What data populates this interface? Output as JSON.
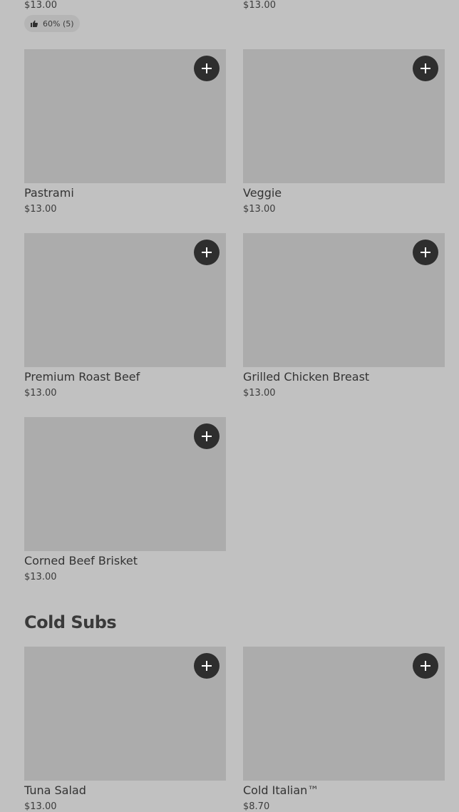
{
  "top_row": {
    "left_price": "$13.00",
    "right_price": "$13.00",
    "rating": {
      "icon": "thumbs-up-icon",
      "text": "60% (5)"
    }
  },
  "items": [
    {
      "name": "Pastrami",
      "price": "$13.00"
    },
    {
      "name": "Veggie",
      "price": "$13.00"
    },
    {
      "name": "Premium Roast Beef",
      "price": "$13.00"
    },
    {
      "name": "Grilled Chicken Breast",
      "price": "$13.00"
    },
    {
      "name": "Corned Beef Brisket",
      "price": "$13.00"
    }
  ],
  "section": {
    "title": "Cold Subs",
    "items": [
      {
        "name": "Tuna Salad",
        "price": "$13.00"
      },
      {
        "name": "Cold Italian™",
        "price": "$8.70"
      }
    ]
  },
  "colors": {
    "background": "#c1c1c1",
    "image_placeholder": "#acacac",
    "add_button": "#2e2e2e"
  }
}
